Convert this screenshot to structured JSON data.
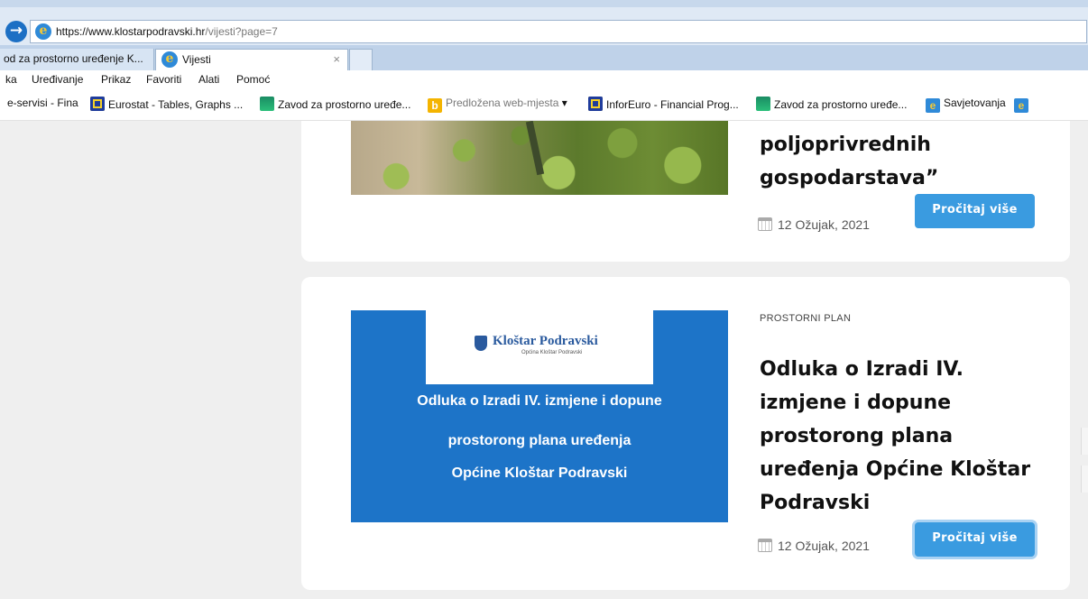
{
  "browser": {
    "url_host": "https://www.klostarpodravski.hr",
    "url_path": "/vijesti?page=7",
    "tabs": [
      {
        "label": "od za prostorno uređenje K..."
      },
      {
        "label": "Vijesti",
        "close": "×"
      }
    ],
    "menu": [
      "ka",
      "Uređivanje",
      "Prikaz",
      "Favoriti",
      "Alati",
      "Pomoć"
    ],
    "favorites": [
      {
        "label": "e-servisi - Fina",
        "icon": "none"
      },
      {
        "label": "Eurostat - Tables, Graphs ...",
        "icon": "eu-flag-icon"
      },
      {
        "label": "Zavod za prostorno uređe...",
        "icon": "green-site-icon"
      },
      {
        "label": "Predložena web-mjesta",
        "icon": "bing-icon",
        "dropdown": "▾"
      },
      {
        "label": "InforEuro - Financial Prog...",
        "icon": "eu-flag-icon"
      },
      {
        "label": "Zavod za prostorno uređe...",
        "icon": "green-site-icon"
      },
      {
        "label": "Savjetovanja",
        "icon": "ie-icon"
      }
    ]
  },
  "articles": [
    {
      "title": "poljoprivrednih gospodarstava”",
      "date": "12 Ožujak, 2021",
      "read_more": "Pročitaj više"
    },
    {
      "category": "PROSTORNI PLAN",
      "image": {
        "logo_name": "Kloštar Podravski",
        "logo_sub": "Općina Kloštar Podravski",
        "lines": [
          "Odluka o Izradi IV. izmjene i dopune",
          "prostorong plana uređenja",
          "Općine Kloštar Podravski"
        ]
      },
      "title": "Odluka o Izradi IV. izmjene i dopune prostorong plana uređenja Općine Kloštar Podravski",
      "date": "12 Ožujak, 2021",
      "read_more": "Pročitaj više"
    }
  ],
  "colors": {
    "button": "#3a9be0",
    "image_blue": "#1d74c8",
    "page_bg": "#efefef"
  }
}
